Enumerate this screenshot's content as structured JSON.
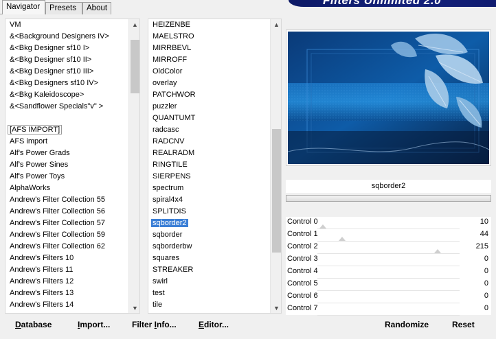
{
  "tabs": [
    "Navigator",
    "Presets",
    "About"
  ],
  "banner_title": "Filters Unlimited 2.0",
  "categories": [
    {
      "label": "VM",
      "state": "normal"
    },
    {
      "label": "&<Background Designers IV>",
      "state": "normal"
    },
    {
      "label": "&<Bkg Designer sf10 I>",
      "state": "normal"
    },
    {
      "label": "&<Bkg Designer sf10 II>",
      "state": "normal"
    },
    {
      "label": "&<Bkg Designer sf10 III>",
      "state": "normal"
    },
    {
      "label": "&<Bkg Designers sf10 IV>",
      "state": "normal"
    },
    {
      "label": "&<Bkg Kaleidoscope>",
      "state": "normal"
    },
    {
      "label": "&<Sandflower Specials\"v\" >",
      "state": "normal"
    },
    {
      "label": "",
      "state": "normal"
    },
    {
      "label": "[AFS IMPORT]",
      "state": "outlined"
    },
    {
      "label": "AFS import",
      "state": "normal"
    },
    {
      "label": "Alf's Power Grads",
      "state": "normal"
    },
    {
      "label": "Alf's Power Sines",
      "state": "normal"
    },
    {
      "label": "Alf's Power Toys",
      "state": "normal"
    },
    {
      "label": "AlphaWorks",
      "state": "normal"
    },
    {
      "label": "Andrew's Filter Collection 55",
      "state": "normal"
    },
    {
      "label": "Andrew's Filter Collection 56",
      "state": "normal"
    },
    {
      "label": "Andrew's Filter Collection 57",
      "state": "normal"
    },
    {
      "label": "Andrew's Filter Collection 59",
      "state": "normal"
    },
    {
      "label": "Andrew's Filter Collection 62",
      "state": "normal"
    },
    {
      "label": "Andrew's Filters 10",
      "state": "normal"
    },
    {
      "label": "Andrew's Filters 11",
      "state": "normal"
    },
    {
      "label": "Andrew's Filters 12",
      "state": "normal"
    },
    {
      "label": "Andrew's Filters 13",
      "state": "normal"
    },
    {
      "label": "Andrew's Filters 14",
      "state": "normal"
    }
  ],
  "filters": [
    {
      "label": "HEIZENBE",
      "state": "normal"
    },
    {
      "label": "MAELSTRO",
      "state": "normal"
    },
    {
      "label": "MIRRBEVL",
      "state": "normal"
    },
    {
      "label": "MIRROFF",
      "state": "normal"
    },
    {
      "label": "OldColor",
      "state": "normal"
    },
    {
      "label": "overlay",
      "state": "normal"
    },
    {
      "label": "PATCHWOR",
      "state": "normal"
    },
    {
      "label": "puzzler",
      "state": "normal"
    },
    {
      "label": "QUANTUMT",
      "state": "normal"
    },
    {
      "label": "radcasc",
      "state": "normal"
    },
    {
      "label": "RADCNV",
      "state": "normal"
    },
    {
      "label": "REALRADM",
      "state": "normal"
    },
    {
      "label": "RINGTILE",
      "state": "normal"
    },
    {
      "label": "SIERPENS",
      "state": "normal"
    },
    {
      "label": "spectrum",
      "state": "normal"
    },
    {
      "label": "spiral4x4",
      "state": "normal"
    },
    {
      "label": "SPLITDIS",
      "state": "normal"
    },
    {
      "label": "sqborder2",
      "state": "selected"
    },
    {
      "label": "sqborder",
      "state": "normal"
    },
    {
      "label": "sqborderbw",
      "state": "normal"
    },
    {
      "label": "squares",
      "state": "normal"
    },
    {
      "label": "STREAKER",
      "state": "normal"
    },
    {
      "label": "swirl",
      "state": "normal"
    },
    {
      "label": "test",
      "state": "normal"
    },
    {
      "label": "tile",
      "state": "normal"
    }
  ],
  "filter_name": "sqborder2",
  "controls": [
    {
      "label": "Control 0",
      "value": "10",
      "level": 10
    },
    {
      "label": "Control 1",
      "value": "44",
      "level": 44
    },
    {
      "label": "Control 2",
      "value": "215",
      "level": 215
    },
    {
      "label": "Control 3",
      "value": "0",
      "level": 0
    },
    {
      "label": "Control 4",
      "value": "0",
      "level": 0
    },
    {
      "label": "Control 5",
      "value": "0",
      "level": 0
    },
    {
      "label": "Control 6",
      "value": "0",
      "level": 0
    },
    {
      "label": "Control 7",
      "value": "0",
      "level": 0
    }
  ],
  "buttons_left": {
    "database": {
      "u": "D",
      "rest": "atabase"
    },
    "import": {
      "u": "I",
      "pre": "",
      "rest": "mport..."
    },
    "filter_info": {
      "pre": "Filter ",
      "u": "I",
      "rest": "nfo..."
    },
    "editor": {
      "u": "E",
      "rest": "ditor..."
    }
  },
  "buttons_right": {
    "randomize": "Randomize",
    "reset": "Reset"
  },
  "colors": {
    "selection": "#3b7fd6",
    "banner": "#14217a",
    "preview_base": "#0c2a52"
  }
}
